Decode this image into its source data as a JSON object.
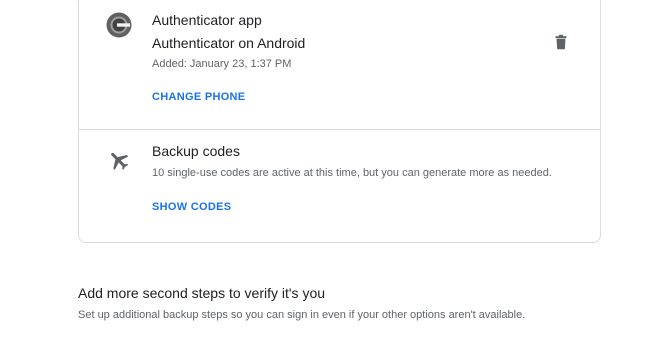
{
  "colors": {
    "accent": "#1a73e8",
    "text_primary": "#202124",
    "text_secondary": "#5f6368",
    "border": "#dadce0"
  },
  "authenticator": {
    "icon": "authenticator-icon",
    "title": "Authenticator app",
    "device": "Authenticator on Android",
    "added": "Added: January 23, 1:37 PM",
    "action": "CHANGE PHONE",
    "delete_icon": "trash-icon"
  },
  "backup": {
    "icon": "airplane-icon",
    "title": "Backup codes",
    "description": "10 single-use codes are active at this time, but you can generate more as needed.",
    "action": "SHOW CODES"
  },
  "more_steps": {
    "title": "Add more second steps to verify it's you",
    "description": "Set up additional backup steps so you can sign in even if your other options aren't available."
  }
}
